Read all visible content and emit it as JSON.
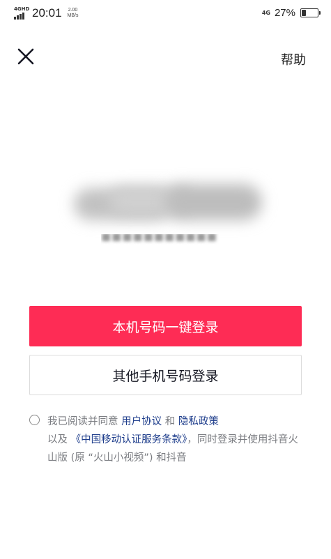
{
  "status_bar": {
    "signal_tag": "4GHD",
    "time": "20:01",
    "net_speed_value": "2.00",
    "net_speed_unit": "MB/s",
    "network": "4G",
    "battery_percent_text": "27%",
    "battery_level": 0.27
  },
  "header": {
    "close_icon": "close-icon",
    "help_label": "帮助"
  },
  "buttons": {
    "one_click_login": "本机号码一键登录",
    "other_phone_login": "其他手机号码登录"
  },
  "agreement": {
    "prefix": "我已阅读并同意 ",
    "user_agreement": "用户协议",
    "and": " 和 ",
    "privacy_policy": "隐私政策",
    "line2_prefix": "以及 ",
    "cmcc_terms": "《中国移动认证服务条款》",
    "line2_suffix": "，同时登录并使用抖音火山版 (原 “火山小视频”) 和抖音"
  },
  "colors": {
    "primary": "#fe2c55",
    "link": "#1f3e8c",
    "muted_text": "#7b7d82"
  }
}
